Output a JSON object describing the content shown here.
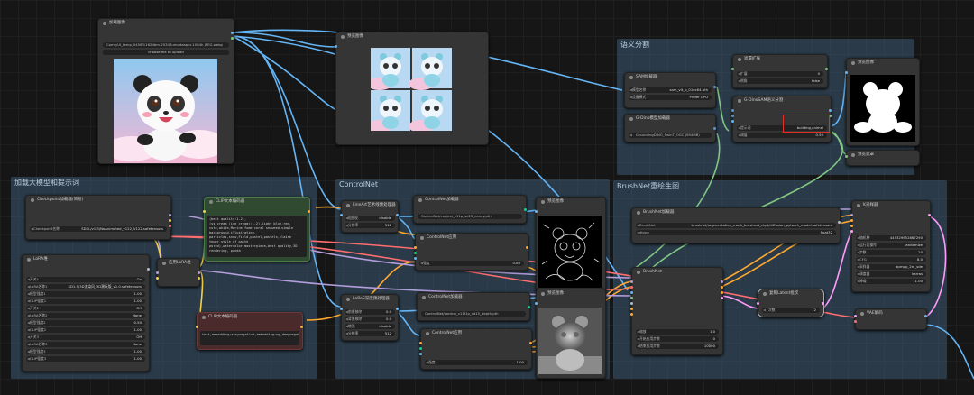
{
  "groups": {
    "load_model": "加载大模型和提示词",
    "controlnet": "ControlNet",
    "segment": "语义分割",
    "brushnet": "BrushNet重绘生图"
  },
  "nodes": {
    "load_image": {
      "title": "加载图像",
      "file": "ComfyUI_temp_0456/1162dbm-25343umodaappr-1084h JPEG.webp",
      "upload": "choose file to upload"
    },
    "preview1": {
      "title": "预览图像"
    },
    "checkpoint": {
      "title": "Checkpoint加载器(简易)",
      "label": "Checkpoint名称",
      "value": "SDXL/v1.5/NoAnimated_v122_V122.safetensors"
    },
    "lora": {
      "title": "LoRA堆",
      "rows": [
        {
          "label": "开关1",
          "value": "On"
        },
        {
          "label": "LoRA名称1",
          "value": "SD1.5/3D渲染风_3D潮玩版_v1.0.safetensors"
        },
        {
          "label": "模型强度1",
          "value": "1.00"
        },
        {
          "label": "CLIP强度1",
          "value": "1.00"
        },
        {
          "label": "开关2",
          "value": "Off"
        },
        {
          "label": "LoRA名称2",
          "value": "None"
        },
        {
          "label": "模型强度2",
          "value": "0.50"
        },
        {
          "label": "CLIP强度2",
          "value": "1.00"
        },
        {
          "label": "开关3",
          "value": "Off"
        },
        {
          "label": "LoRA名称3",
          "value": "None"
        },
        {
          "label": "模型强度3",
          "value": "1.00"
        },
        {
          "label": "CLIP强度3",
          "value": "1.00"
        }
      ]
    },
    "apply_lora": {
      "title": "应用LoRA堆"
    },
    "clip_pos": {
      "title": "CLIP文本编码器",
      "text": "(best quality:1.2),(ss_cream_(ice_cream):1.2),light blue,red, cute,white,Marine fume,coral seaweed,simple background,illustration, particles,snow,Field,pastel,pastels,claire tower,style of paste pored),watercolor,masterpiece,best quality,3D rendering, panda"
    },
    "clip_neg": {
      "title": "CLIP文本编码器",
      "text": "text,embedding:easynegative,embedding:ng_deepnegative_v1_75t,"
    },
    "lineart": {
      "title": "LineArt艺术线预处理器",
      "rows": [
        {
          "label": "粗细化",
          "value": "disable"
        },
        {
          "label": "分辨率",
          "value": "512"
        }
      ]
    },
    "cn_loader1": {
      "title": "ControlNet加载器",
      "value": "ControlNet/control_v11p_sd15_canny.pth"
    },
    "cn_apply1": {
      "title": "ControlNet应用",
      "label": "强度",
      "value": "0.80"
    },
    "preview_lineart": {
      "title": "预览图像"
    },
    "leres": {
      "title": "LeReS深度预处理器",
      "rows": [
        {
          "label": "前景移除",
          "value": "0.0"
        },
        {
          "label": "背景移除",
          "value": "0.0"
        },
        {
          "label": "增强",
          "value": "disable"
        },
        {
          "label": "分辨率",
          "value": "512"
        }
      ]
    },
    "cn_loader2": {
      "title": "ControlNet加载器",
      "value": "ControlNet/control_v11f1p_sd15_depth.pth"
    },
    "cn_apply2": {
      "title": "ControlNet应用",
      "label": "强度",
      "value": "1.00"
    },
    "preview_depth": {
      "title": "预览图像"
    },
    "sam_loader": {
      "title": "SAM加载器",
      "rows": [
        {
          "label": "模型名称",
          "value": "sam_vit_b_01ec64.pth"
        },
        {
          "label": "设备模式",
          "value": "Prefer GPU"
        }
      ]
    },
    "gdino_loader": {
      "title": "G-Dino模型加载器",
      "value": "GroundingDINO_SwinT_OGC (694MB)"
    },
    "mask_expand": {
      "title": "遮罩扩展",
      "rows": [
        {
          "label": "扩展",
          "value": "0"
        },
        {
          "label": "倒角",
          "value": "false"
        }
      ]
    },
    "gdino_sam": {
      "title": "G-DinoSAM语义分割",
      "rows": [
        {
          "label": "提示词",
          "value": "building,animal"
        },
        {
          "label": "阈值",
          "value": "0.50"
        }
      ]
    },
    "preview_mask": {
      "title": "预览图像"
    },
    "preview_mask2": {
      "title": "预览遮罩"
    },
    "brushnet_loader": {
      "title": "BrushNet加载器",
      "rows": [
        {
          "label": "BrushNet",
          "value": "brushnet/segmentation_mask_brushnet_ckpt/diffusion_pytorch_model.safetensors"
        },
        {
          "label": "dtype",
          "value": "float32"
        }
      ]
    },
    "brushnet": {
      "title": "BrushNet",
      "rows": [
        {
          "label": "缩放",
          "value": "1.0"
        },
        {
          "label": "开始应用步数",
          "value": "0"
        },
        {
          "label": "结束应用步数",
          "value": "10000"
        }
      ]
    },
    "ksampler": {
      "title": "K采样器",
      "rows": [
        {
          "label": "随机种",
          "value": "445329952867290"
        },
        {
          "label": "运行后操作",
          "value": "randomize"
        },
        {
          "label": "步数",
          "value": "20"
        },
        {
          "label": "CFG",
          "value": "8.0"
        },
        {
          "label": "采样器",
          "value": "dpmpp_2m_sde"
        },
        {
          "label": "调度器",
          "value": "karras"
        },
        {
          "label": "降噪",
          "value": "1.00"
        }
      ]
    },
    "latent_batch": {
      "title": "复制Latent批次",
      "label": "次数",
      "value": "2"
    },
    "vae_decode": {
      "title": "VAE解码"
    }
  },
  "colors": {
    "accent_red": "#e0302a",
    "group_blue": "#3c5a73",
    "model_port": "#b39ddb",
    "clip_port": "#f5d04b",
    "cond_port": "#ffa931",
    "image_port": "#64b5f6",
    "mask_port": "#81c784",
    "latent_port": "#ff9cf9",
    "vae_port": "#ff6e6e"
  }
}
